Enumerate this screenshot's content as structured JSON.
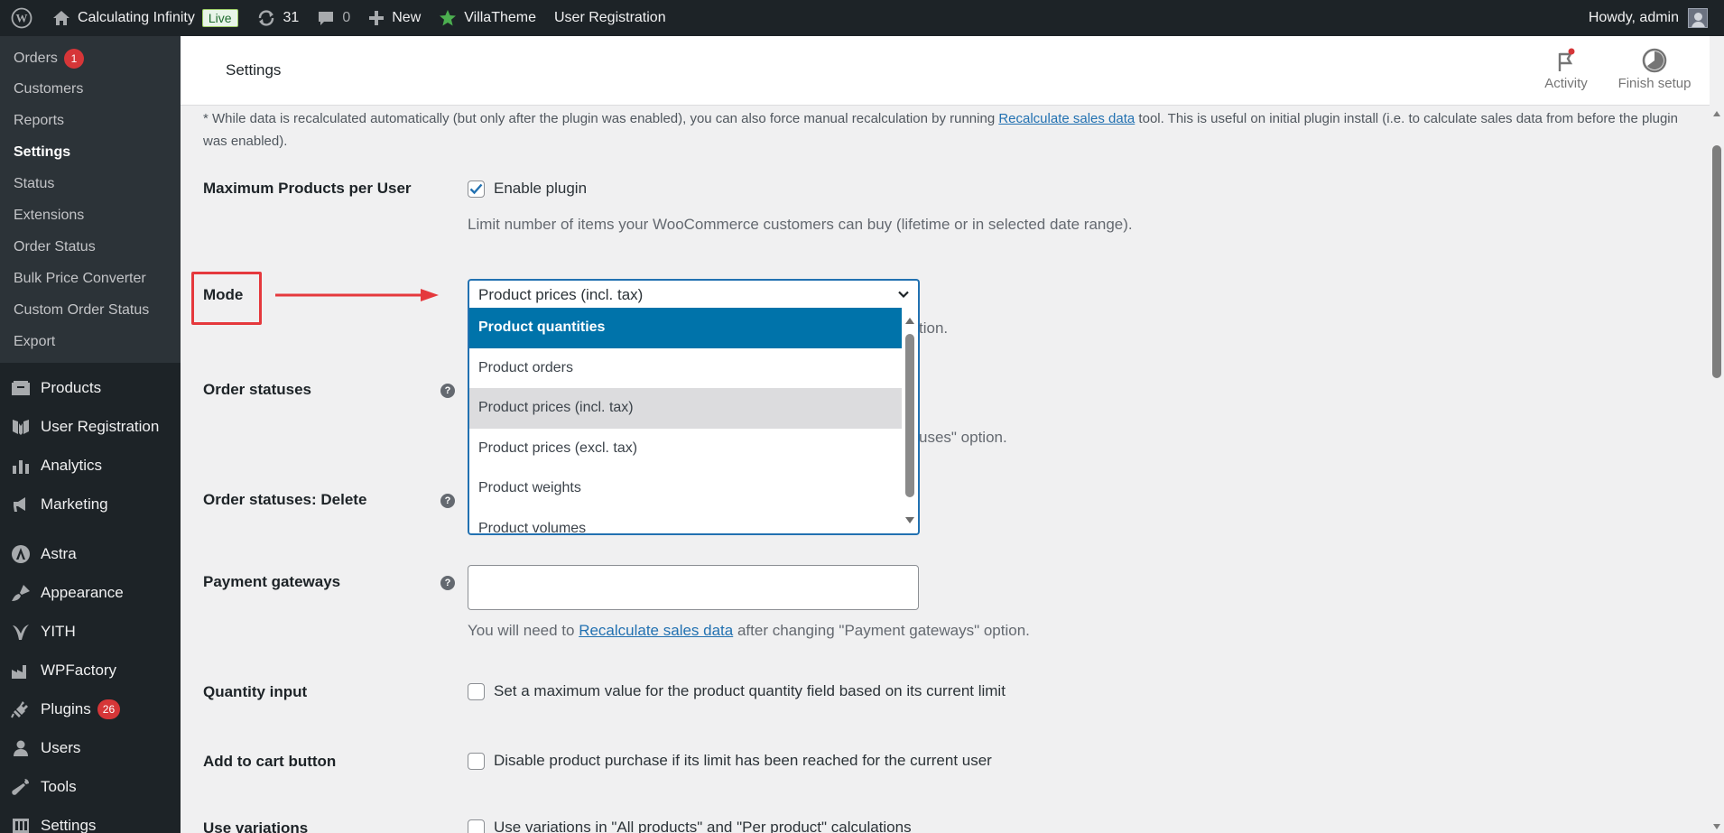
{
  "adminbar": {
    "site_name": "Calculating Infinity",
    "live_badge": "Live",
    "updates_count": "31",
    "comments_count": "0",
    "new_label": "New",
    "villatheme_label": "VillaTheme",
    "user_registration_label": "User Registration",
    "howdy": "Howdy, admin"
  },
  "sidebar": {
    "submenu": [
      {
        "label": "Orders",
        "badge": "1"
      },
      {
        "label": "Customers"
      },
      {
        "label": "Reports"
      },
      {
        "label": "Settings",
        "current": true
      },
      {
        "label": "Status"
      },
      {
        "label": "Extensions"
      },
      {
        "label": "Order Status"
      },
      {
        "label": "Bulk Price Converter"
      },
      {
        "label": "Custom Order Status"
      },
      {
        "label": "Export"
      }
    ],
    "menu": [
      {
        "label": "Products",
        "icon": "products-icon"
      },
      {
        "label": "User Registration",
        "icon": "user-registration-icon"
      },
      {
        "label": "Analytics",
        "icon": "analytics-icon"
      },
      {
        "label": "Marketing",
        "icon": "marketing-icon"
      },
      {
        "label": "Astra",
        "icon": "astra-icon"
      },
      {
        "label": "Appearance",
        "icon": "appearance-icon"
      },
      {
        "label": "YITH",
        "icon": "yith-icon"
      },
      {
        "label": "WPFactory",
        "icon": "wpfactory-icon"
      },
      {
        "label": "Plugins",
        "icon": "plugins-icon",
        "badge": "26"
      },
      {
        "label": "Users",
        "icon": "users-icon"
      },
      {
        "label": "Tools",
        "icon": "tools-icon"
      },
      {
        "label": "Settings",
        "icon": "settings-icon"
      }
    ]
  },
  "header": {
    "title": "Settings",
    "activity_label": "Activity",
    "finish_setup_label": "Finish setup"
  },
  "main": {
    "note_text": "* While data is recalculated automatically (but only after the plugin was enabled), you can also force manual recalculation by running ",
    "note_link": "Recalculate sales data",
    "note_text_after": " tool. This is useful on initial plugin install (i.e. to calculate sales data from before the plugin was enabled).",
    "max_products_label": "Maximum Products per User",
    "enable_plugin_label": "Enable plugin",
    "enable_plugin_checked": true,
    "enable_plugin_desc": "Limit number of items your WooCommerce customers can buy (lifetime or in selected date range).",
    "mode_label": "Mode",
    "mode_value": "Product prices (incl. tax)",
    "mode_desc_tail": "tion.",
    "mode_options": [
      {
        "label": "Product quantities",
        "state": "selected"
      },
      {
        "label": "Product orders",
        "state": ""
      },
      {
        "label": "Product prices (incl. tax)",
        "state": "hover"
      },
      {
        "label": "Product prices (excl. tax)",
        "state": ""
      },
      {
        "label": "Product weights",
        "state": ""
      },
      {
        "label": "Product volumes",
        "state": ""
      }
    ],
    "order_statuses_label": "Order statuses",
    "order_statuses_desc_tail": "uses\" option.",
    "order_statuses_delete_label": "Order statuses: Delete",
    "payment_gateways_label": "Payment gateways",
    "payment_desc_before": "You will need to ",
    "payment_desc_link": "Recalculate sales data",
    "payment_desc_after": " after changing \"Payment gateways\" option.",
    "quantity_input_label": "Quantity input",
    "quantity_input_desc": "Set a maximum value for the product quantity field based on its current limit",
    "add_to_cart_label": "Add to cart button",
    "add_to_cart_desc": "Disable product purchase if its limit has been reached for the current user",
    "use_variations_label": "Use variations",
    "use_variations_desc": "Use variations in \"All products\" and \"Per product\" calculations"
  },
  "colors": {
    "accent": "#2271b1",
    "highlight": "#e5393d",
    "selected_option": "#0073aa"
  }
}
